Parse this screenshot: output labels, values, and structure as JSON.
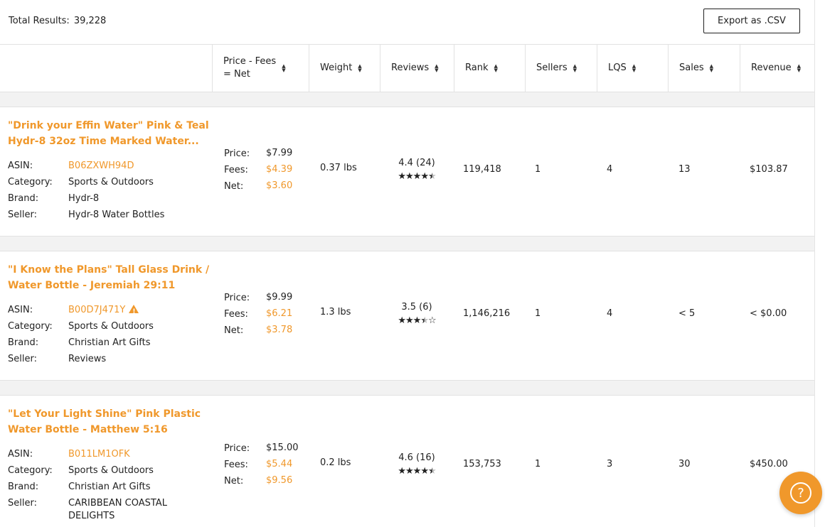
{
  "header": {
    "total_label": "Total Results:",
    "total_value": "39,228",
    "export_label": "Export as .CSV"
  },
  "columns": [
    {
      "line1": "Price - Fees",
      "line2": "= Net"
    },
    {
      "line1": "Weight",
      "line2": ""
    },
    {
      "line1": "Reviews",
      "line2": ""
    },
    {
      "line1": "Rank",
      "line2": ""
    },
    {
      "line1": "Sellers",
      "line2": ""
    },
    {
      "line1": "LQS",
      "line2": ""
    },
    {
      "line1": "Sales",
      "line2": ""
    },
    {
      "line1": "Revenue",
      "line2": ""
    }
  ],
  "labels": {
    "asin": "ASIN:",
    "category": "Category:",
    "brand": "Brand:",
    "seller": "Seller:",
    "price": "Price:",
    "fees": "Fees:",
    "net": "Net:"
  },
  "products": [
    {
      "title_line1": "\"Drink your Effin Water\" Pink & Teal",
      "title_line2": "Hydr-8 32oz Time Marked Water...",
      "asin": "B06ZXWH94D",
      "category": "Sports & Outdoors",
      "brand": "Hydr-8",
      "seller_line1": "Hydr-8 Water Bottles",
      "seller_line2": "",
      "price": "$7.99",
      "fees": "$4.39",
      "net": "$3.60",
      "weight": "0.37 lbs",
      "reviews": "4.4 (24)",
      "rating": 4.4,
      "rank": "119,418",
      "sellers": "1",
      "lqs": "4",
      "sales": "13",
      "revenue": "$103.87",
      "warning": false
    },
    {
      "title_line1": "\"I Know the Plans\" Tall Glass Drink /",
      "title_line2": "Water Bottle - Jeremiah 29:11",
      "asin": "B00D7J471Y",
      "category": "Sports & Outdoors",
      "brand": "Christian Art Gifts",
      "seller_line1": "Reviews",
      "seller_line2": "",
      "price": "$9.99",
      "fees": "$6.21",
      "net": "$3.78",
      "weight": "1.3 lbs",
      "reviews": "3.5 (6)",
      "rating": 3.5,
      "rank": "1,146,216",
      "sellers": "1",
      "lqs": "4",
      "sales": "< 5",
      "revenue": "< $0.00",
      "warning": true
    },
    {
      "title_line1": "\"Let Your Light Shine\" Pink Plastic",
      "title_line2": "Water Bottle - Matthew 5:16",
      "asin": "B011LM1OFK",
      "category": "Sports & Outdoors",
      "brand": "Christian Art Gifts",
      "seller_line1": "CARIBBEAN COASTAL",
      "seller_line2": "DELIGHTS",
      "price": "$15.00",
      "fees": "$5.44",
      "net": "$9.56",
      "weight": "0.2 lbs",
      "reviews": "4.6 (16)",
      "rating": 4.6,
      "rank": "153,753",
      "sellers": "1",
      "lqs": "3",
      "sales": "30",
      "revenue": "$450.00",
      "warning": false
    }
  ],
  "colors": {
    "accent": "#f0982b",
    "text": "#222222",
    "divider": "#e2e2e2",
    "gap": "#f2f2f2"
  },
  "icons": {
    "sort": "sort-arrows-icon",
    "warning": "warning-triangle-icon",
    "help": "help-question-icon",
    "star": "star-icon"
  }
}
